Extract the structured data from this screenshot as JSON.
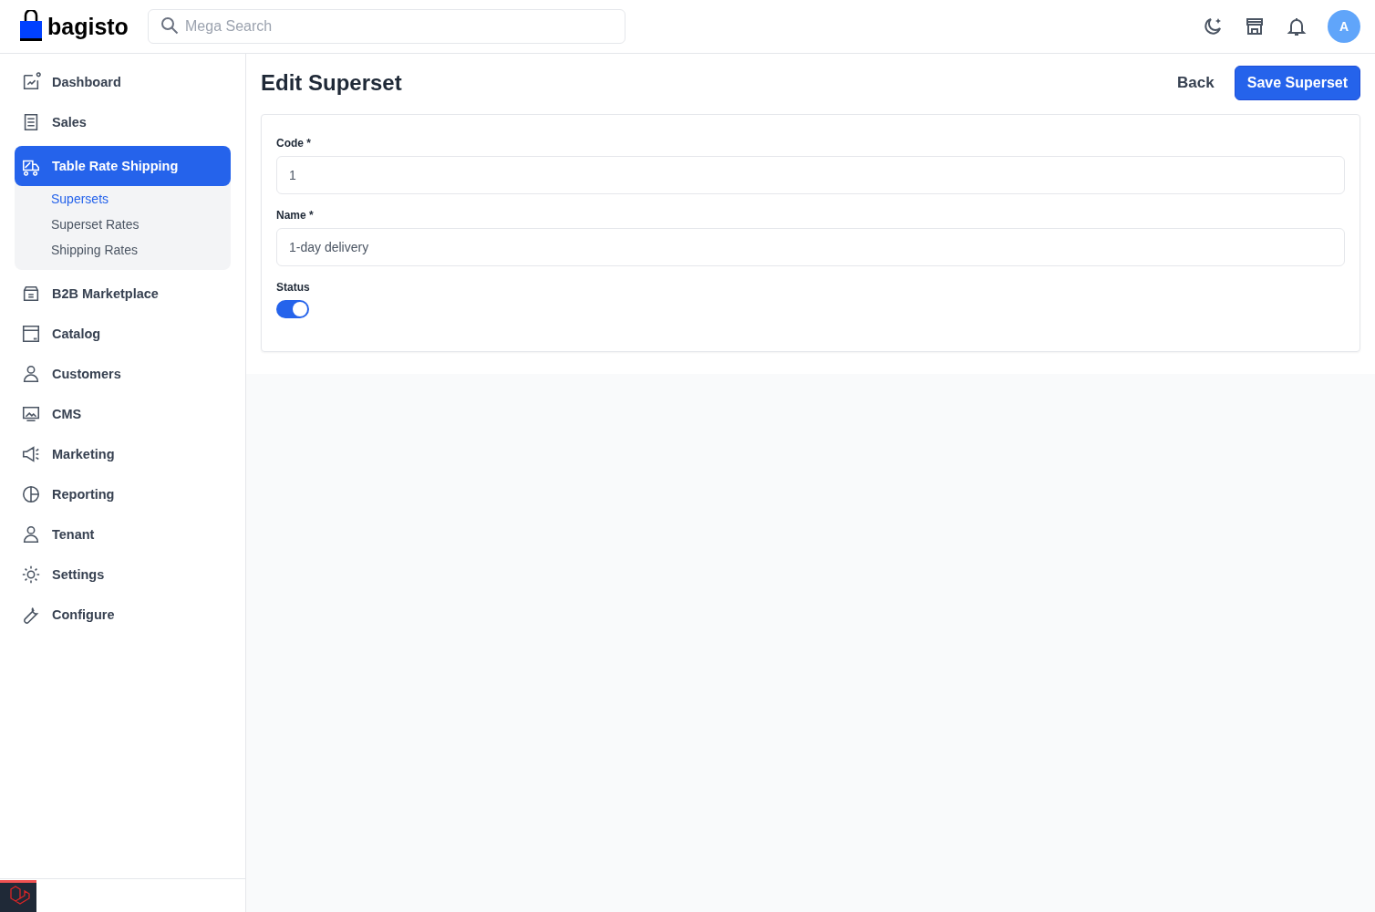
{
  "header": {
    "logo": "bagisto",
    "search": {
      "placeholder": "Mega Search"
    },
    "avatar": "A"
  },
  "sidebar": {
    "items": [
      {
        "label": "Dashboard",
        "selected": false
      },
      {
        "label": "Sales",
        "selected": false
      },
      {
        "label": "Table Rate Shipping",
        "selected": true,
        "expanded": true,
        "children": [
          {
            "label": "Supersets",
            "selected": true
          },
          {
            "label": "Superset Rates",
            "selected": false
          },
          {
            "label": "Shipping Rates",
            "selected": false
          }
        ]
      },
      {
        "label": "B2B Marketplace",
        "selected": false
      },
      {
        "label": "Catalog",
        "selected": false
      },
      {
        "label": "Customers",
        "selected": false
      },
      {
        "label": "CMS",
        "selected": false
      },
      {
        "label": "Marketing",
        "selected": false
      },
      {
        "label": "Reporting",
        "selected": false
      },
      {
        "label": "Tenant",
        "selected": false
      },
      {
        "label": "Settings",
        "selected": false
      },
      {
        "label": "Configure",
        "selected": false
      }
    ]
  },
  "page": {
    "title": "Edit Superset",
    "back": "Back",
    "save": "Save Superset"
  },
  "form": {
    "fields": [
      {
        "label": "Code *",
        "value": "1"
      },
      {
        "label": "Name *",
        "value": "1-day delivery"
      }
    ],
    "status": {
      "label": "Status",
      "on": true
    }
  }
}
